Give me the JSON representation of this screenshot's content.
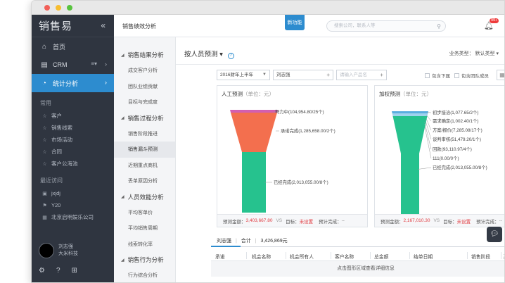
{
  "sidebar": {
    "logo": "销售易",
    "collapse_icon": "«",
    "nav": [
      {
        "label": "首页",
        "icon": "⌂"
      },
      {
        "label": "CRM",
        "icon": "▤",
        "extra": "≡▾",
        "arrow": "›"
      },
      {
        "label": "统计分析",
        "icon": "◔",
        "arrow": "›"
      }
    ],
    "common_title": "常用",
    "common": [
      "客户",
      "销售线索",
      "市场活动",
      "合同",
      "客户公海池"
    ],
    "recent_title": "最近访问",
    "recent": [
      "jxjdj",
      "Y20",
      "北京启明娱乐公司"
    ],
    "user_name": "刘志强",
    "user_company": "大米科技"
  },
  "topbar": {
    "title": "销售绩效分析",
    "new_badge": "新功能",
    "search_placeholder": "搜索公司，联系人等",
    "bell_count": "99+"
  },
  "submenu": {
    "groups": [
      {
        "title": "销售结果分析",
        "items": [
          "成交客户分析",
          "团队业绩贡献",
          "目标与完成度"
        ]
      },
      {
        "title": "销售过程分析",
        "items": [
          "销售阶段推进",
          "销售漏斗预测",
          "近期重点商机",
          "丢单原因分析"
        ]
      },
      {
        "title": "人员效能分析",
        "items": [
          "平均客单价",
          "平均销售周期",
          "线索转化率"
        ]
      },
      {
        "title": "销售行为分析",
        "items": [
          "行为综合分析"
        ]
      }
    ],
    "active": "销售漏斗预测"
  },
  "main": {
    "heading": "按人员预测",
    "help": "?",
    "biz_type_label": "业务类型：",
    "biz_type_value": "默认类型",
    "period": "2016财年上半年",
    "person": "刘志强",
    "product_placeholder": "请输入产品名",
    "include_sub": "包含下属",
    "include_team": "包含团队成员",
    "manual": {
      "title": "人工预测",
      "unit": "（单位：元）",
      "stages": [
        {
          "label": "努力中(104,954.80/25个)",
          "value": 104954.8,
          "color": "#d35fb0"
        },
        {
          "label": "承诺完成(1,285,658.00/2个)",
          "value": 1285658.0,
          "color": "#f36f4e"
        },
        {
          "label": "已经完成(2,013,055.00/8个)",
          "value": 2013055.0,
          "color": "#26c28e"
        }
      ],
      "forecast_label": "预测金额：",
      "forecast_value": "3,403,667.80",
      "target_label": "目标：",
      "target_value": "未设置",
      "vs": "VS",
      "completion_label": "预计完成：",
      "completion_value": "--"
    },
    "weighted": {
      "title": "加权预测",
      "unit": "（单位：元）",
      "stages": [
        {
          "label": "初步接洽(1,077.65/2个)",
          "value": 1077.65,
          "color": "#5aaee0"
        },
        {
          "label": "需求确定(1,002.40/1个)",
          "value": 1002.4,
          "color": "#9fd2ee"
        },
        {
          "label": "方案/报价(7,285.08/17个)",
          "value": 7285.08,
          "color": "#26c28e"
        },
        {
          "label": "谈判审核(51,479.20/1个)",
          "value": 51479.2,
          "color": "#26c28e"
        },
        {
          "label": "回款(93,110.97/4个)",
          "value": 93110.97,
          "color": "#26c28e"
        },
        {
          "label": "111(0.00/0个)",
          "value": 0,
          "color": "#26c28e"
        },
        {
          "label": "已经完成(2,013,055.00/8个)",
          "value": 2013055.0,
          "color": "#26c28e"
        }
      ],
      "forecast_label": "预测金额：",
      "forecast_value": "2,167,010.30",
      "target_label": "目标：",
      "target_value": "未设置",
      "vs": "VS",
      "completion_label": "预计完成：",
      "completion_value": "--"
    },
    "summary": {
      "name": "刘志强",
      "total_label": "合计",
      "total": "3,426,869元"
    },
    "columns": [
      "承诺",
      "机会名称",
      "机会所有人",
      "客户名称",
      "总金额",
      "结单日期",
      "销售阶段",
      "赢率"
    ],
    "table_note": "点击图形区域查看详细信息",
    "more_icon": "···"
  }
}
